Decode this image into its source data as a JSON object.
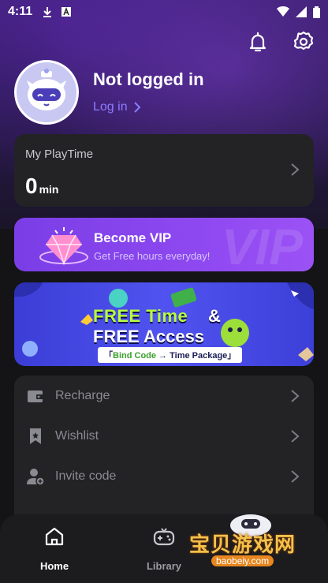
{
  "status_bar": {
    "time": "4:11"
  },
  "header": {
    "icons": [
      "bell-icon",
      "gear-icon"
    ],
    "username": "Not logged in",
    "login_label": "Log in"
  },
  "playtime": {
    "label": "My PlayTime",
    "value": "0",
    "unit": "min"
  },
  "vip": {
    "title": "Become VIP",
    "subtitle": "Get Free hours everyday!",
    "watermark": "VIP"
  },
  "banner": {
    "line1_a": "FREE Time",
    "amp": "&",
    "line2": "FREE Access",
    "pill_open": "「",
    "pill_code": "Bind Code",
    "pill_arrow": " → ",
    "pill_pkg": "Time Package",
    "pill_close": "」"
  },
  "menu": {
    "items": [
      {
        "label": "Recharge",
        "icon": "wallet-icon"
      },
      {
        "label": "Wishlist",
        "icon": "bookmark-icon"
      },
      {
        "label": "Invite code",
        "icon": "add-user-icon"
      }
    ]
  },
  "nav": {
    "home_label": "Home",
    "library_label": "Library"
  },
  "watermark": {
    "text": "宝贝游戏网",
    "sub": "baobeiy.com"
  },
  "colors": {
    "accent": "#8b7cff",
    "vip": "#8e48f0",
    "card": "#232326",
    "bg": "#141416"
  }
}
